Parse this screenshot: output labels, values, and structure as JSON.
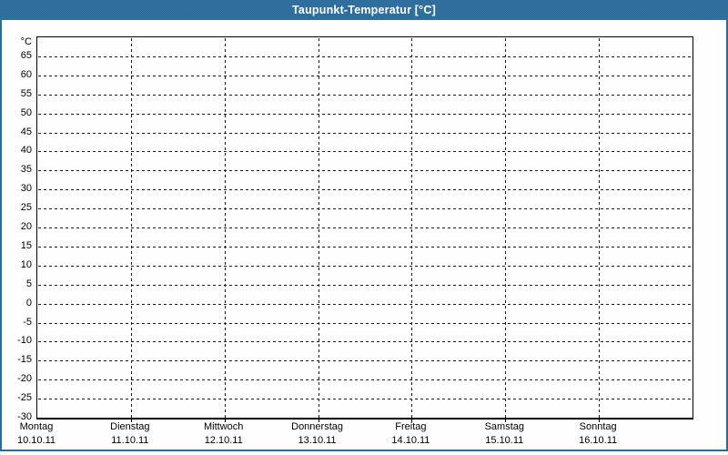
{
  "window": {
    "title": "Taupunkt-Temperatur [°C]"
  },
  "colors": {
    "titlebar": "#2a6b9c",
    "titlebar_texture": "#34739f",
    "window_border": "#2a6b9c",
    "background": "#fdfefd",
    "grid_line": "#1a1a1a",
    "axis_frame": "#000000",
    "title_text": "#ffffff",
    "label_text": "#000000"
  },
  "chart_data": {
    "type": "line",
    "title": "Taupunkt-Temperatur [°C]",
    "xlabel": "",
    "ylabel": "°C",
    "ylim": [
      -30,
      70
    ],
    "ytick_step": 5,
    "yticks": [
      65,
      60,
      55,
      50,
      45,
      40,
      35,
      30,
      25,
      20,
      15,
      10,
      5,
      0,
      -5,
      -10,
      -15,
      -20,
      -25,
      -30
    ],
    "categories": [
      "Montag",
      "Dienstag",
      "Mittwoch",
      "Donnerstag",
      "Freitag",
      "Samstag",
      "Sonntag"
    ],
    "x_days": [
      {
        "name": "Montag",
        "date": "10.10.11"
      },
      {
        "name": "Dienstag",
        "date": "11.10.11"
      },
      {
        "name": "Mittwoch",
        "date": "12.10.11"
      },
      {
        "name": "Donnerstag",
        "date": "13.10.11"
      },
      {
        "name": "Freitag",
        "date": "14.10.11"
      },
      {
        "name": "Samstag",
        "date": "15.10.11"
      },
      {
        "name": "Sonntag",
        "date": "16.10.11"
      }
    ],
    "series": [],
    "grid": "dashed",
    "legend": "none"
  }
}
